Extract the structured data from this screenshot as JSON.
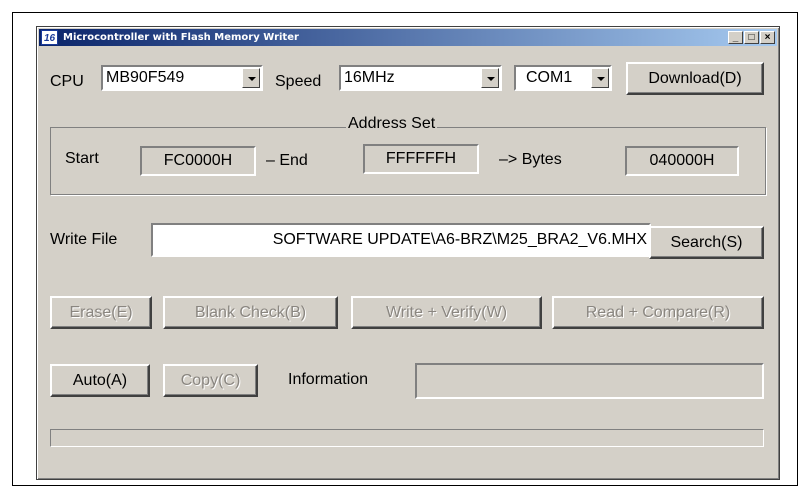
{
  "window": {
    "title": "Microcontroller with Flash Memory Writer",
    "icon_text": "16",
    "min_label": "_",
    "max_label": "□",
    "close_label": "×"
  },
  "cpu": {
    "label": "CPU",
    "value": "MB90F549"
  },
  "speed": {
    "label": "Speed",
    "value": "16MHz"
  },
  "port": {
    "value": "COM1"
  },
  "download_button": "Download(D)",
  "address_set": {
    "title": "Address Set",
    "start_label": "Start",
    "start_value": "FC0000H",
    "end_label": "– End",
    "end_value": "FFFFFFH",
    "bytes_label": "–> Bytes",
    "bytes_value": "040000H"
  },
  "write_file": {
    "label": "Write File",
    "value": "SOFTWARE UPDATE\\A6-BRZ\\M25_BRA2_V6.MHX",
    "search_button": "Search(S)"
  },
  "actions": {
    "erase": "Erase(E)",
    "blank_check": "Blank Check(B)",
    "write_verify": "Write + Verify(W)",
    "read_compare": "Read + Compare(R)"
  },
  "bottom": {
    "auto": "Auto(A)",
    "copy": "Copy(C)",
    "information_label": "Information",
    "information_value": ""
  },
  "progress": {
    "value": 0
  }
}
